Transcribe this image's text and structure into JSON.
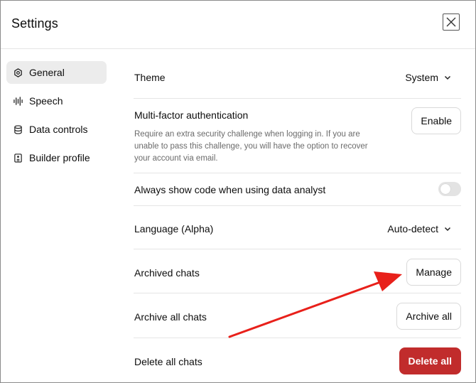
{
  "header": {
    "title": "Settings",
    "close_icon": "close-icon"
  },
  "sidebar": {
    "items": [
      {
        "label": "General",
        "icon": "gear-icon",
        "active": true
      },
      {
        "label": "Speech",
        "icon": "waveform-icon",
        "active": false
      },
      {
        "label": "Data controls",
        "icon": "database-icon",
        "active": false
      },
      {
        "label": "Builder profile",
        "icon": "id-badge-icon",
        "active": false
      }
    ]
  },
  "settings": {
    "theme": {
      "label": "Theme",
      "value": "System"
    },
    "mfa": {
      "label": "Multi-factor authentication",
      "description": "Require an extra security challenge when logging in. If you are unable to pass this challenge, you will have the option to recover your account via email.",
      "button": "Enable"
    },
    "code": {
      "label": "Always show code when using data analyst",
      "enabled": false
    },
    "language": {
      "label": "Language (Alpha)",
      "value": "Auto-detect"
    },
    "archived": {
      "label": "Archived chats",
      "button": "Manage"
    },
    "archive_all": {
      "label": "Archive all chats",
      "button": "Archive all"
    },
    "delete_all": {
      "label": "Delete all chats",
      "button": "Delete all"
    }
  },
  "colors": {
    "danger": "#c12c2c",
    "annotation_arrow": "#e8201a",
    "active_nav": "#ececec"
  }
}
